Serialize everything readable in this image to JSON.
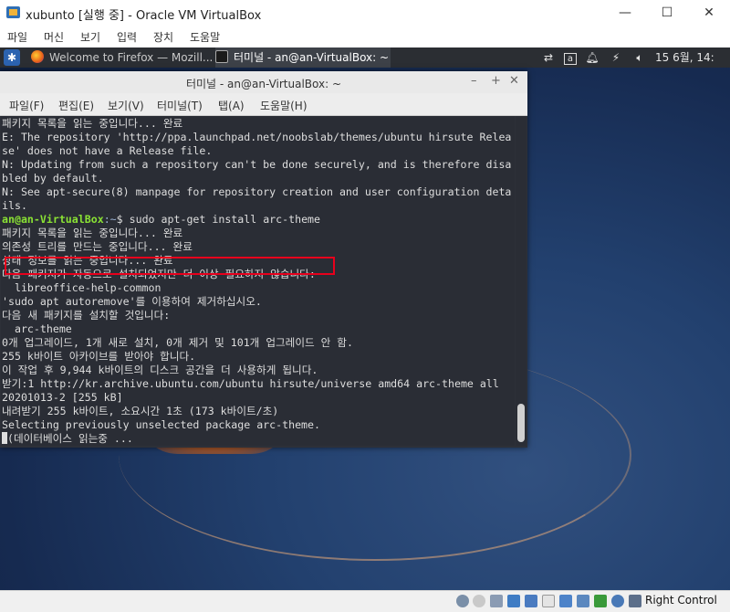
{
  "vbox": {
    "title": "xubunto [실행 중] - Oracle VM VirtualBox",
    "controls": {
      "minimize": "—",
      "maximize": "☐",
      "close": "✕"
    },
    "menu": [
      "파일",
      "머신",
      "보기",
      "입력",
      "장치",
      "도움말"
    ],
    "host_key": "Right Control"
  },
  "panel": {
    "tasks": [
      {
        "label": "Welcome to Firefox — Mozill..."
      },
      {
        "label": "터미널 - an@an-VirtualBox: ~"
      }
    ],
    "clock": "15 6월, 14:"
  },
  "terminal": {
    "title": "터미널 - an@an-VirtualBox: ~",
    "buttons": {
      "minimize": "–",
      "maximize": "+",
      "close": "✕"
    },
    "menu": [
      "파일(F)",
      "편집(E)",
      "보기(V)",
      "터미널(T)",
      "탭(A)",
      "도움말(H)"
    ],
    "lines_before": [
      "패키지 목록을 읽는 중입니다... 완료",
      "E: The repository 'http://ppa.launchpad.net/noobslab/themes/ubuntu hirsute Relea",
      "se' does not have a Release file.",
      "N: Updating from such a repository can't be done securely, and is therefore disa",
      "bled by default.",
      "N: See apt-secure(8) manpage for repository creation and user configuration deta",
      "ils."
    ],
    "prompt": {
      "user": "an@an-VirtualBox",
      "path": ":~",
      "symbol": "$",
      "command": " sudo apt-get install arc-theme"
    },
    "lines_after": [
      "패키지 목록을 읽는 중입니다... 완료",
      "의존성 트리를 만드는 중입니다... 완료",
      "상태 정보를 읽는 중입니다... 완료",
      "다음 패키지가 자동으로 설치되었지만 더 이상 필요하지 않습니다:",
      "  libreoffice-help-common",
      "'sudo apt autoremove'를 이용하여 제거하십시오.",
      "다음 새 패키지를 설치할 것입니다:",
      "  arc-theme",
      "0개 업그레이드, 1개 새로 설치, 0개 제거 및 101개 업그레이드 안 함.",
      "255 k바이트 아카이브를 받아야 합니다.",
      "이 작업 후 9,944 k바이트의 디스크 공간을 더 사용하게 됩니다.",
      "받기:1 http://kr.archive.ubuntu.com/ubuntu hirsute/universe amd64 arc-theme all",
      "20201013-2 [255 kB]",
      "내려받기 255 k바이트, 소요시간 1초 (173 k바이트/초)",
      "Selecting previously unselected package arc-theme.",
      "(데이터베이스 읽는중 ..."
    ]
  },
  "colors": {
    "terminal_bg": "#2a2d35",
    "prompt_user": "#8ae234",
    "highlight_box": "#e8001c"
  }
}
